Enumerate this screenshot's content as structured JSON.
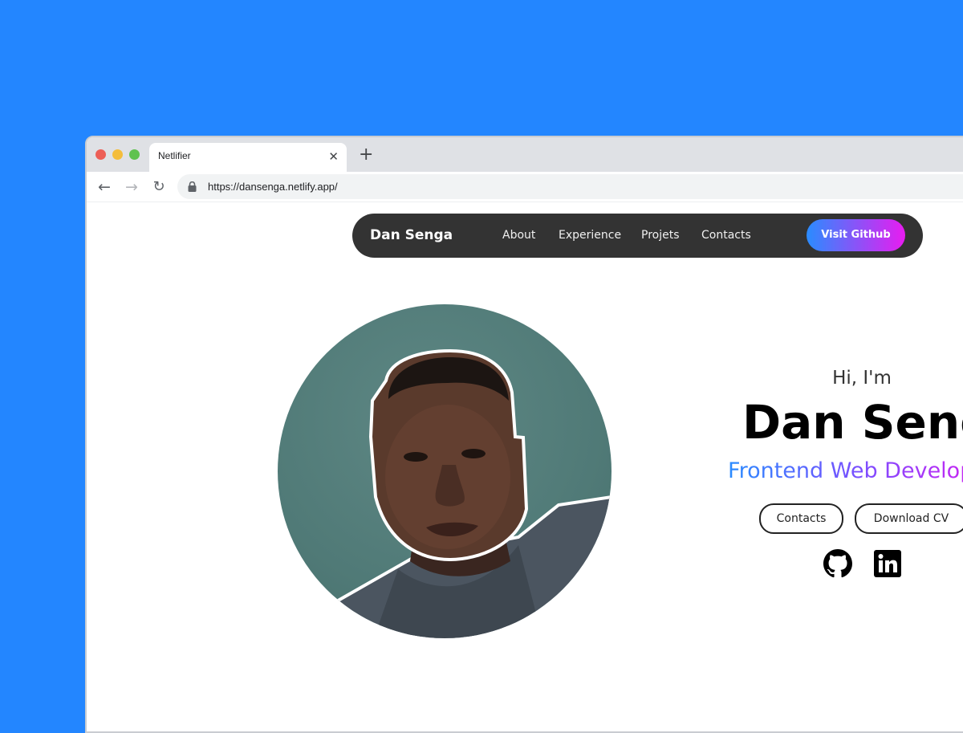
{
  "browser": {
    "tab_title": "Netlifier",
    "tab_close_glyph": "✕",
    "new_tab_glyph": "+",
    "back_glyph": "←",
    "forward_glyph": "→",
    "reload_glyph": "↻",
    "url": "https://dansenga.netlify.app/",
    "lock_icon": "lock-icon"
  },
  "navbar": {
    "brand": "Dan Senga",
    "links": [
      "About",
      "Experience",
      "Projets",
      "Contacts"
    ],
    "cta_label": "Visit Github"
  },
  "hero": {
    "greeting": "Hi, I'm",
    "name": "Dan Senga",
    "role": "Frontend Web Developer",
    "buttons": {
      "contacts": "Contacts",
      "download_cv": "Download CV"
    },
    "socials": [
      "github-icon",
      "linkedin-icon"
    ],
    "avatar": "profile-photo"
  },
  "colors": {
    "page_background": "#2386ff",
    "navbar_background": "#333333",
    "gradient_start": "#2a8cff",
    "gradient_end": "#e81cf0",
    "avatar_background": "#507a77"
  }
}
